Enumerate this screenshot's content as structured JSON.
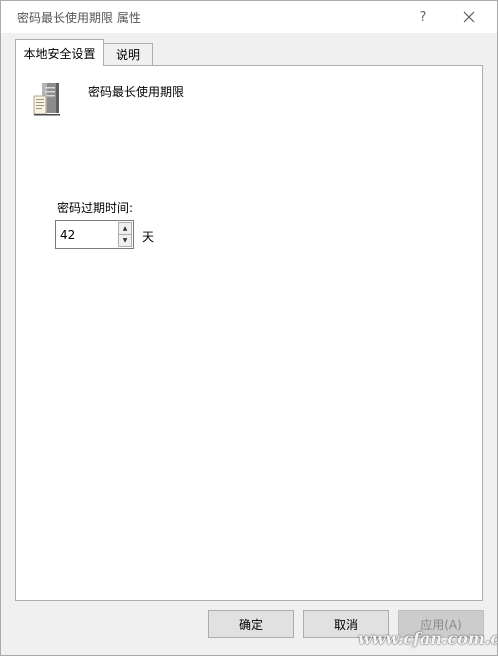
{
  "window": {
    "title": "密码最长使用期限 属性",
    "help_glyph": "?"
  },
  "tabs": [
    {
      "label": "本地安全设置",
      "active": true
    },
    {
      "label": "说明",
      "active": false
    }
  ],
  "policy": {
    "icon": "server-icon",
    "name": "密码最长使用期限",
    "field_label": "密码过期时间:",
    "value": "42",
    "unit": "天"
  },
  "buttons": {
    "ok": "确定",
    "cancel": "取消",
    "apply": "应用(A)"
  },
  "watermark": "www.cfan.com.cn"
}
